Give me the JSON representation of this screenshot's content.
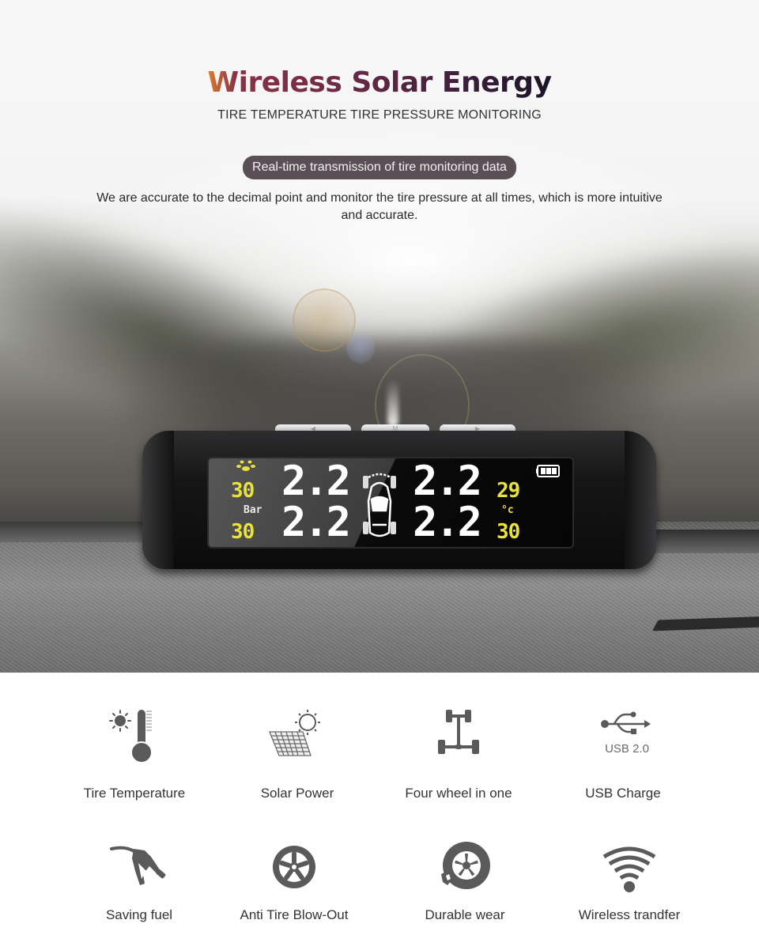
{
  "header": {
    "title": "Wireless Solar Energy",
    "subtitle": "TIRE TEMPERATURE TIRE PRESSURE MONITORING",
    "badge": "Real-time transmission of tire monitoring data",
    "description": "We are accurate to the decimal point and monitor the tire pressure at all times, which is more intuitive and accurate."
  },
  "device": {
    "buttons": [
      {
        "label": "◀",
        "icon": "left-arrow-icon"
      },
      {
        "label": "M",
        "icon": "mode-icon"
      },
      {
        "label": "▶",
        "icon": "right-arrow-icon"
      }
    ],
    "display": {
      "pressure_unit": "Bar",
      "temperature_unit": "°c",
      "front_left_pressure": "2.2",
      "front_right_pressure": "2.2",
      "rear_left_pressure": "2.2",
      "rear_right_pressure": "2.2",
      "front_left_temp": "30",
      "rear_left_temp": "30",
      "front_right_temp": "29",
      "rear_right_temp": "30",
      "battery_level": 1.0
    },
    "colors": {
      "segment_yellow": "#e8e23a",
      "segment_white": "#ffffff"
    }
  },
  "features": [
    {
      "label": "Tire Temperature",
      "icon": "thermometer-sun-icon"
    },
    {
      "label": "Solar Power",
      "icon": "solar-panel-icon"
    },
    {
      "label": "Four wheel in one",
      "icon": "four-wheel-axle-icon"
    },
    {
      "label": "USB Charge",
      "icon": "usb-icon",
      "icon_text": "USB  2.0"
    },
    {
      "label": "Saving fuel",
      "icon": "fuel-nozzle-icon"
    },
    {
      "label": "Anti Tire Blow-Out",
      "icon": "tire-wheel-icon"
    },
    {
      "label": "Durable wear",
      "icon": "durable-tire-icon"
    },
    {
      "label": "Wireless trandfer",
      "icon": "wireless-signal-icon"
    }
  ],
  "theme": {
    "icon_gray": "#5a5a5a",
    "badge_bg": "#5b4f56",
    "title_gradient": [
      "#e07a2e",
      "#6a2a46",
      "#1b1526"
    ]
  }
}
